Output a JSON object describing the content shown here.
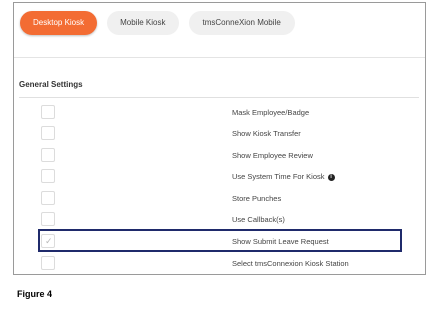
{
  "tabs": [
    {
      "label": "Desktop Kiosk",
      "active": true
    },
    {
      "label": "Mobile Kiosk",
      "active": false
    },
    {
      "label": "tmsConneXion Mobile",
      "active": false
    }
  ],
  "section": {
    "title": "General Settings"
  },
  "settings": [
    {
      "label": "Mask Employee/Badge",
      "checked": false
    },
    {
      "label": "Show Kiosk Transfer",
      "checked": false
    },
    {
      "label": "Show Employee Review",
      "checked": false
    },
    {
      "label": "Use System Time For Kiosk",
      "checked": false,
      "info": true
    },
    {
      "label": "Store Punches",
      "checked": false
    },
    {
      "label": "Use Callback(s)",
      "checked": false
    },
    {
      "label": "Show Submit Leave Request",
      "checked": true,
      "highlighted": true
    },
    {
      "label": "Select tmsConnexion Kiosk Station",
      "checked": false
    }
  ],
  "icons": {
    "check": "checkmark-icon",
    "info": "info-icon"
  },
  "colors": {
    "accent": "#f36c33",
    "highlight_border": "#1f2a6b"
  },
  "caption": "Figure 4"
}
